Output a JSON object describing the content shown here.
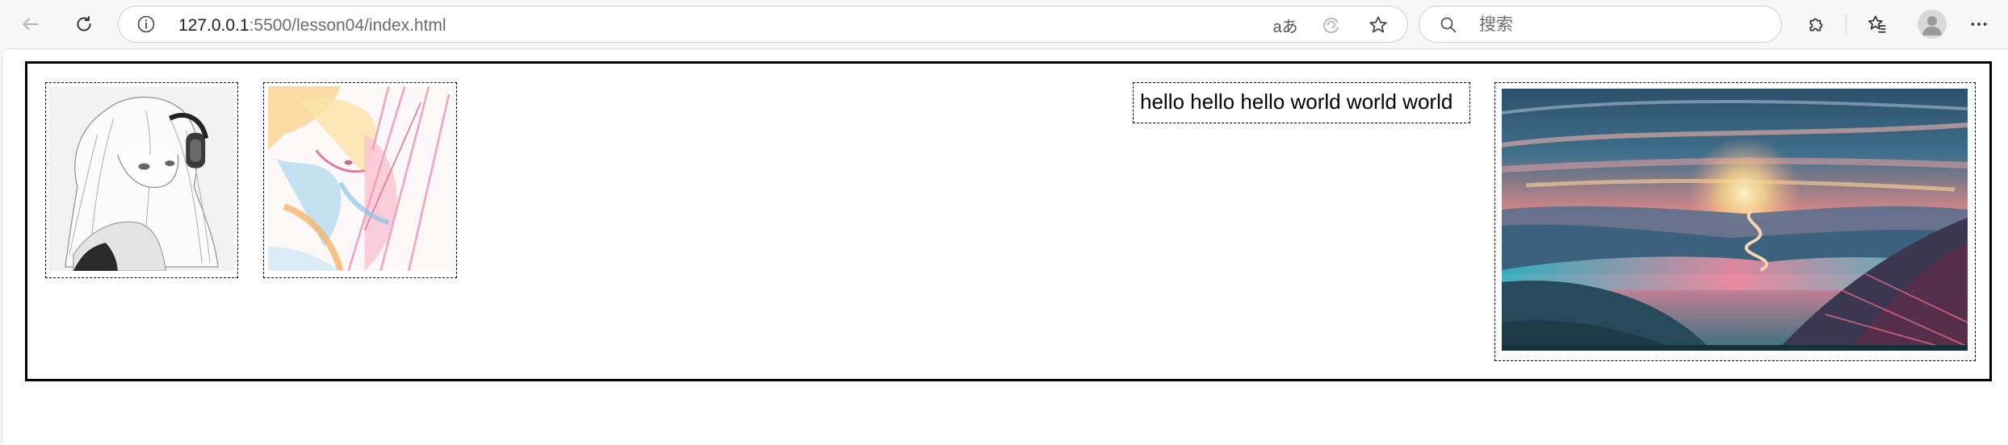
{
  "browser": {
    "url_host": "127.0.0.1",
    "url_rest": ":5500/lesson04/index.html",
    "read_aloud_label": "aあ",
    "search_placeholder": "搜索"
  },
  "icons": {
    "back": "back-arrow-icon",
    "refresh": "refresh-icon",
    "site_info": "info-icon",
    "read_aloud": "read-aloud-icon",
    "browser_essentials": "browser-essentials-icon",
    "favorite": "star-icon",
    "search": "search-icon",
    "extensions": "puzzle-icon",
    "favorites": "favorites-icon",
    "profile": "profile-avatar-icon",
    "more": "more-icon"
  },
  "page": {
    "text": "hello hello hello world world world"
  },
  "colors": {
    "container_border": "#000000",
    "chrome_bg": "#f7f7f7"
  }
}
